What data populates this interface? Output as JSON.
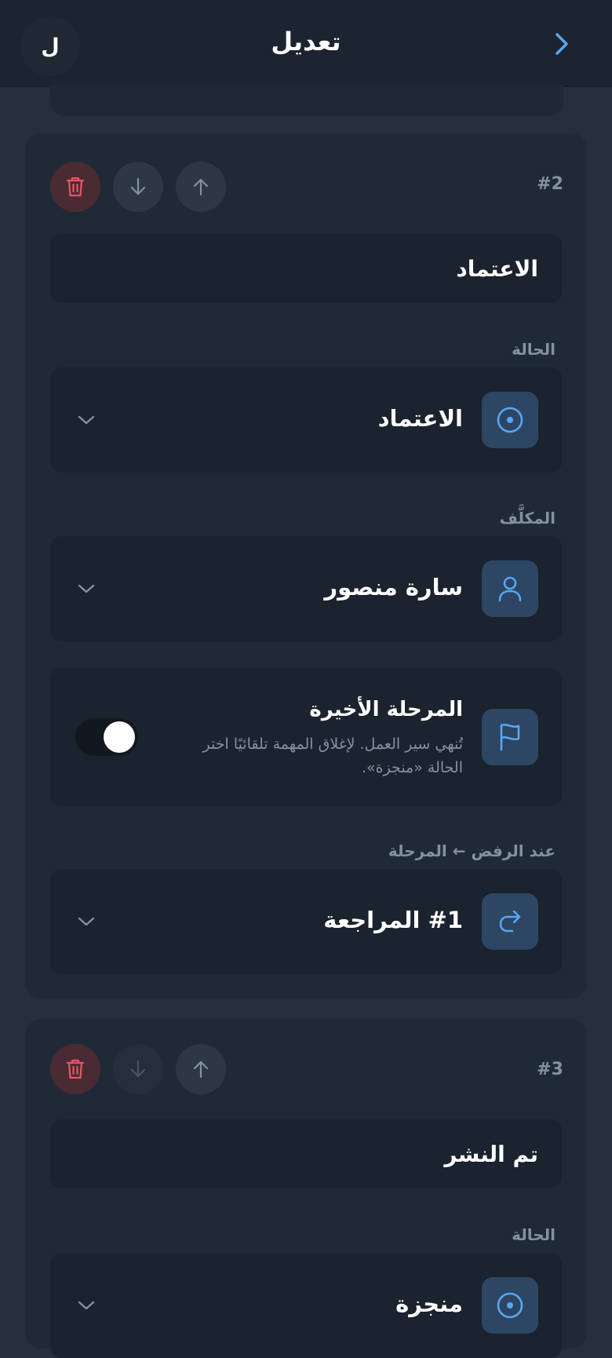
{
  "header": {
    "avatar_letter": "ل",
    "title": "تعديل",
    "back_icon": "chevron-right-icon"
  },
  "steps": [
    {
      "number": "#2",
      "name": "الاعتماد",
      "status_label": "الحالة",
      "status_value": "الاعتماد",
      "assignee_label": "المكلَّف",
      "assignee_value": "سارة منصور",
      "final_title": "المرحلة الأخيرة",
      "final_desc": "تُنهي سير العمل. لإغلاق المهمة تلقائيًا اختر الحالة «منجزة».",
      "final_enabled": false,
      "reject_label": "عند الرفض ← المرحلة",
      "reject_value": "#1 المراجعة",
      "move_down_enabled": true
    },
    {
      "number": "#3",
      "name": "تم النشر",
      "status_label": "الحالة",
      "status_value": "منجزة",
      "move_down_enabled": false
    }
  ],
  "colors": {
    "accent": "#5aa6f0",
    "delete": "#e05a63",
    "background": "#26303c",
    "card": "#202a36",
    "field": "#1a232e"
  }
}
